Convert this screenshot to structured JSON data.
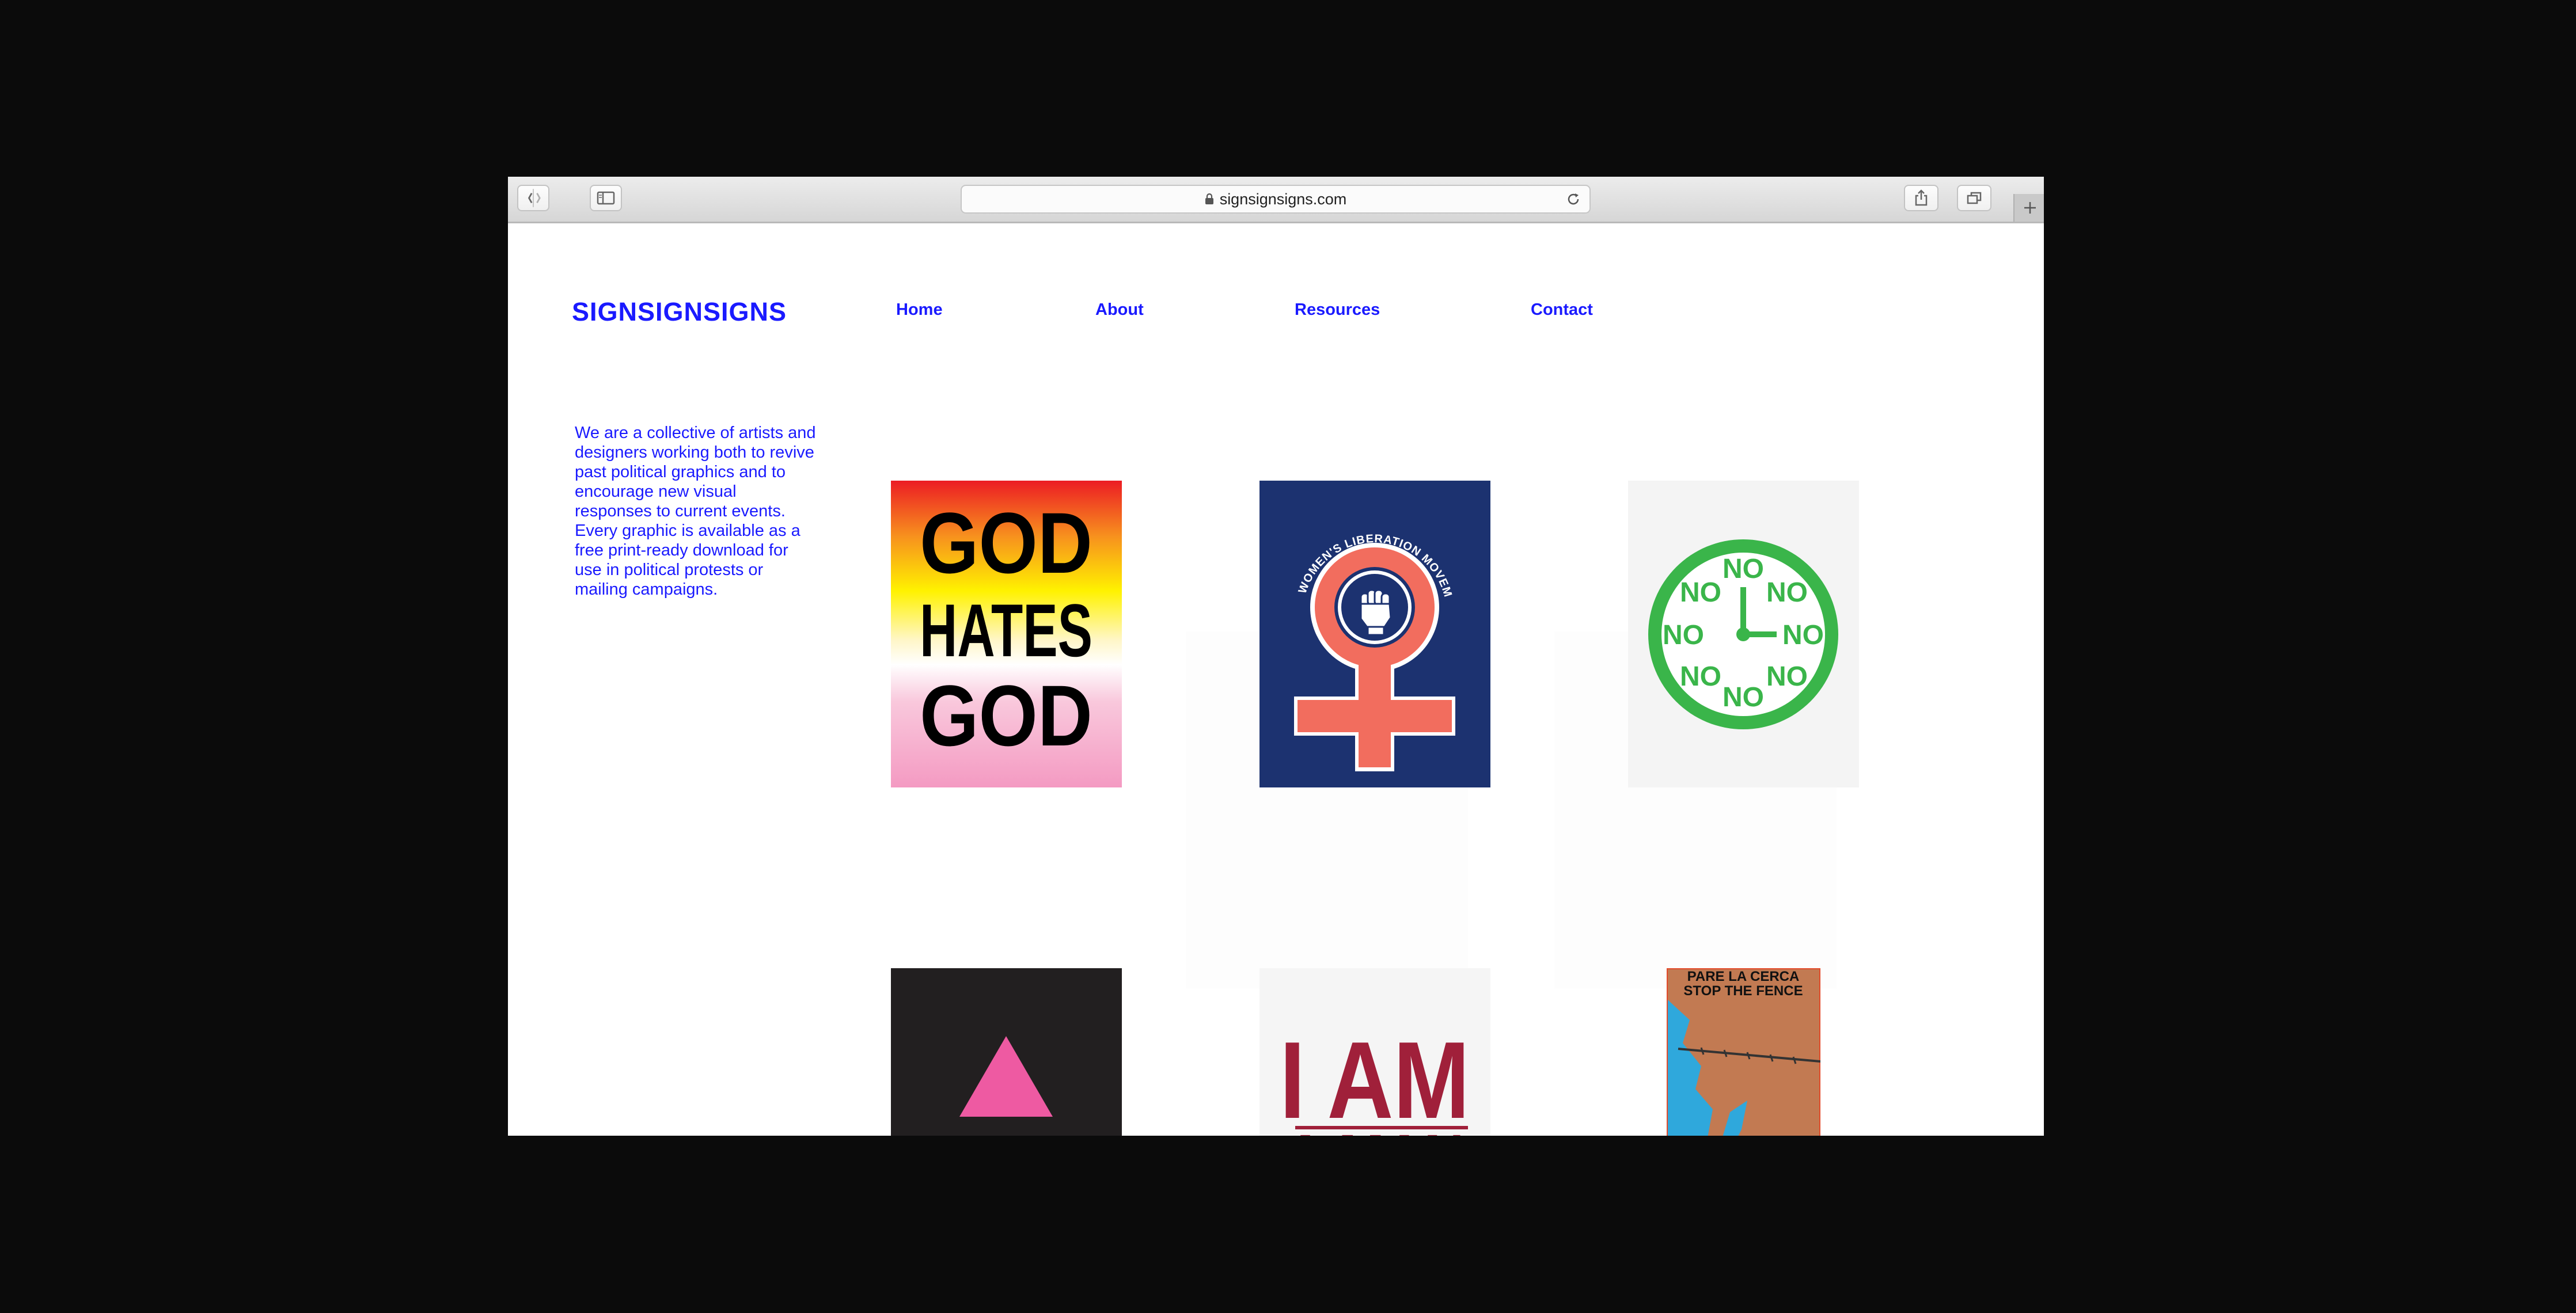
{
  "browser": {
    "url": "signsignsigns.com"
  },
  "site": {
    "logo": "SIGNSIGNSIGNS",
    "nav": [
      "Home",
      "About",
      "Resources",
      "Contact"
    ],
    "intro": "We are a collective of artists and designers working both to revive past political graphics and to encourage new visual responses to current events. Every graphic is available as a free print-ready download for use in political protests or mailing campaigns."
  },
  "posters": {
    "god_hates_god": {
      "line1": "GOD",
      "line2": "HATES",
      "line3": "GOD"
    },
    "womens_liberation": {
      "arc_text": "THE WOMEN'S LIBERATION MOVEMENT"
    },
    "no_clock": {
      "word": "NO"
    },
    "pink_triangle": {},
    "i_am_a_man": {
      "line1": "I AM",
      "line2": "A MAN"
    },
    "stop_the_fence": {
      "line1": "PARE LA CERCA",
      "line2": "STOP THE FENCE"
    }
  },
  "colors": {
    "brand_blue": "#1a1aff",
    "clock_green": "#3ab54a",
    "venus_red": "#f26d5e",
    "liberation_navy": "#1c3270",
    "triangle_pink": "#ee5aa2",
    "man_red": "#a0203a",
    "fence_brown": "#c27a52"
  }
}
